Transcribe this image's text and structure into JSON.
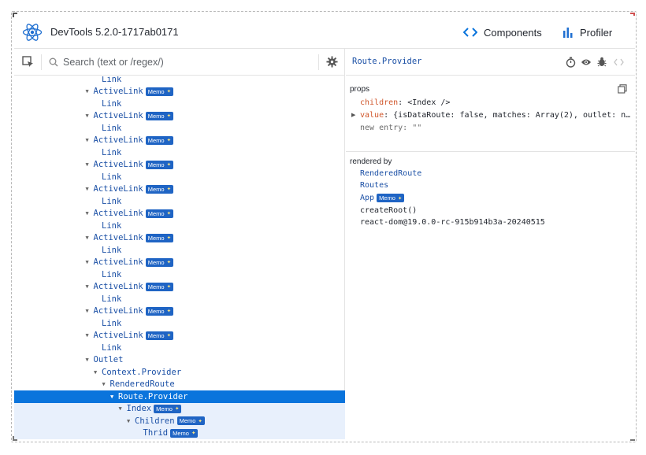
{
  "app": {
    "title": "DevTools 5.2.0-1717ab0171"
  },
  "tabs": [
    {
      "label": "Components",
      "icon": "code-brackets-icon",
      "active": true
    },
    {
      "label": "Profiler",
      "icon": "bar-chart-icon",
      "active": false
    }
  ],
  "search": {
    "placeholder": "Search (text or /regex/)",
    "value": ""
  },
  "badge": {
    "memo": "Memo"
  },
  "tree": [
    {
      "label": "Link",
      "depth": 2,
      "arrow": "",
      "badge": false
    },
    {
      "label": "ActiveLink",
      "depth": 1,
      "arrow": "▼",
      "badge": true
    },
    {
      "label": "Link",
      "depth": 2,
      "arrow": "",
      "badge": false
    },
    {
      "label": "ActiveLink",
      "depth": 1,
      "arrow": "▼",
      "badge": true
    },
    {
      "label": "Link",
      "depth": 2,
      "arrow": "",
      "badge": false
    },
    {
      "label": "ActiveLink",
      "depth": 1,
      "arrow": "▼",
      "badge": true
    },
    {
      "label": "Link",
      "depth": 2,
      "arrow": "",
      "badge": false
    },
    {
      "label": "ActiveLink",
      "depth": 1,
      "arrow": "▼",
      "badge": true
    },
    {
      "label": "Link",
      "depth": 2,
      "arrow": "",
      "badge": false
    },
    {
      "label": "ActiveLink",
      "depth": 1,
      "arrow": "▼",
      "badge": true
    },
    {
      "label": "Link",
      "depth": 2,
      "arrow": "",
      "badge": false
    },
    {
      "label": "ActiveLink",
      "depth": 1,
      "arrow": "▼",
      "badge": true
    },
    {
      "label": "Link",
      "depth": 2,
      "arrow": "",
      "badge": false
    },
    {
      "label": "ActiveLink",
      "depth": 1,
      "arrow": "▼",
      "badge": true
    },
    {
      "label": "Link",
      "depth": 2,
      "arrow": "",
      "badge": false
    },
    {
      "label": "ActiveLink",
      "depth": 1,
      "arrow": "▼",
      "badge": true
    },
    {
      "label": "Link",
      "depth": 2,
      "arrow": "",
      "badge": false
    },
    {
      "label": "ActiveLink",
      "depth": 1,
      "arrow": "▼",
      "badge": true
    },
    {
      "label": "Link",
      "depth": 2,
      "arrow": "",
      "badge": false
    },
    {
      "label": "ActiveLink",
      "depth": 1,
      "arrow": "▼",
      "badge": true
    },
    {
      "label": "Link",
      "depth": 2,
      "arrow": "",
      "badge": false
    },
    {
      "label": "ActiveLink",
      "depth": 1,
      "arrow": "▼",
      "badge": true
    },
    {
      "label": "Link",
      "depth": 2,
      "arrow": "",
      "badge": false
    },
    {
      "label": "Outlet",
      "depth": 1,
      "arrow": "▼",
      "badge": false
    },
    {
      "label": "Context.Provider",
      "depth": 2,
      "arrow": "▼",
      "badge": false
    },
    {
      "label": "RenderedRoute",
      "depth": 3,
      "arrow": "▼",
      "badge": false
    },
    {
      "label": "Route.Provider",
      "depth": 4,
      "arrow": "▼",
      "badge": false,
      "state": "selected"
    },
    {
      "label": "Index",
      "depth": 5,
      "arrow": "▼",
      "badge": true,
      "state": "in-selected"
    },
    {
      "label": "Children",
      "depth": 6,
      "arrow": "▼",
      "badge": true,
      "state": "in-selected"
    },
    {
      "label": "Thrid",
      "depth": 7,
      "arrow": "",
      "badge": true,
      "state": "in-selected"
    }
  ],
  "inspector": {
    "selected_name": "Route.Provider",
    "props_label": "props",
    "props": {
      "children_key": "children",
      "children_value": "<Index />",
      "value_key": "value",
      "value_value": "{isDataRoute: false, matches: Array(2), outlet: n…",
      "new_entry": "new entry: \"\""
    },
    "rendered_by_label": "rendered by",
    "rendered_by": {
      "item1": "RenderedRoute",
      "item2": "Routes",
      "item3": "App",
      "item4": "createRoot()",
      "item5": "react-dom@19.0.0-rc-915b914b3a-20240515"
    }
  },
  "colors": {
    "accent": "#0a74dc",
    "component_name": "#1a4fa5",
    "prop_key": "#d0562b",
    "memo_badge": "#1f64c4"
  }
}
